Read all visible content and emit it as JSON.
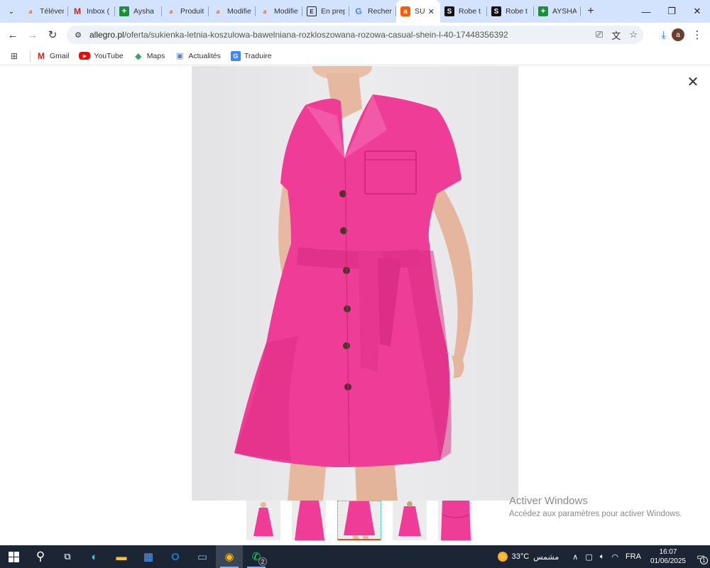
{
  "browser": {
    "tabs": [
      {
        "label": "Télévent",
        "favicon": "allegro-icon"
      },
      {
        "label": "Inbox (",
        "favicon": "gmail-icon"
      },
      {
        "label": "Aysha",
        "favicon": "sheets-icon"
      },
      {
        "label": "Produit",
        "favicon": "allegro-icon"
      },
      {
        "label": "Modifie",
        "favicon": "allegro-icon"
      },
      {
        "label": "Modifie",
        "favicon": "allegro-icon"
      },
      {
        "label": "En prep",
        "favicon": "e-icon"
      },
      {
        "label": "Recherc",
        "favicon": "google-icon"
      },
      {
        "label": "SU",
        "favicon": "allegro-a-icon",
        "active": true
      },
      {
        "label": "Robe t",
        "favicon": "s-icon"
      },
      {
        "label": "Robe t",
        "favicon": "s-icon"
      },
      {
        "label": "AYSHA",
        "favicon": "sheets-icon"
      }
    ],
    "url_host": "allegro.pl",
    "url_path": "/oferta/sukienka-letnia-koszulowa-bawelniana-rozkloszowana-rozowa-casual-shein-l-40-17448356392",
    "avatar_letter": "a",
    "bookmarks": [
      {
        "label": "Gmail",
        "icon": "gmail-icon"
      },
      {
        "label": "YouTube",
        "icon": "youtube-icon"
      },
      {
        "label": "Maps",
        "icon": "maps-icon"
      },
      {
        "label": "Actualités",
        "icon": "news-icon"
      },
      {
        "label": "Traduire",
        "icon": "translate-icon"
      }
    ]
  },
  "viewer": {
    "dress_color": "#ee3c97",
    "thumbnail_count": 5,
    "selected_thumbnail": 3
  },
  "watermark": {
    "title": "Activer Windows",
    "subtitle": "Accédez aux paramètres pour activer Windows."
  },
  "taskbar": {
    "weather_temp": "33°C",
    "weather_label": "مشمس",
    "language": "FRA",
    "time": "16:07",
    "date": "01/06/2025",
    "whatsapp_badge": "2",
    "notification_count": "1"
  }
}
